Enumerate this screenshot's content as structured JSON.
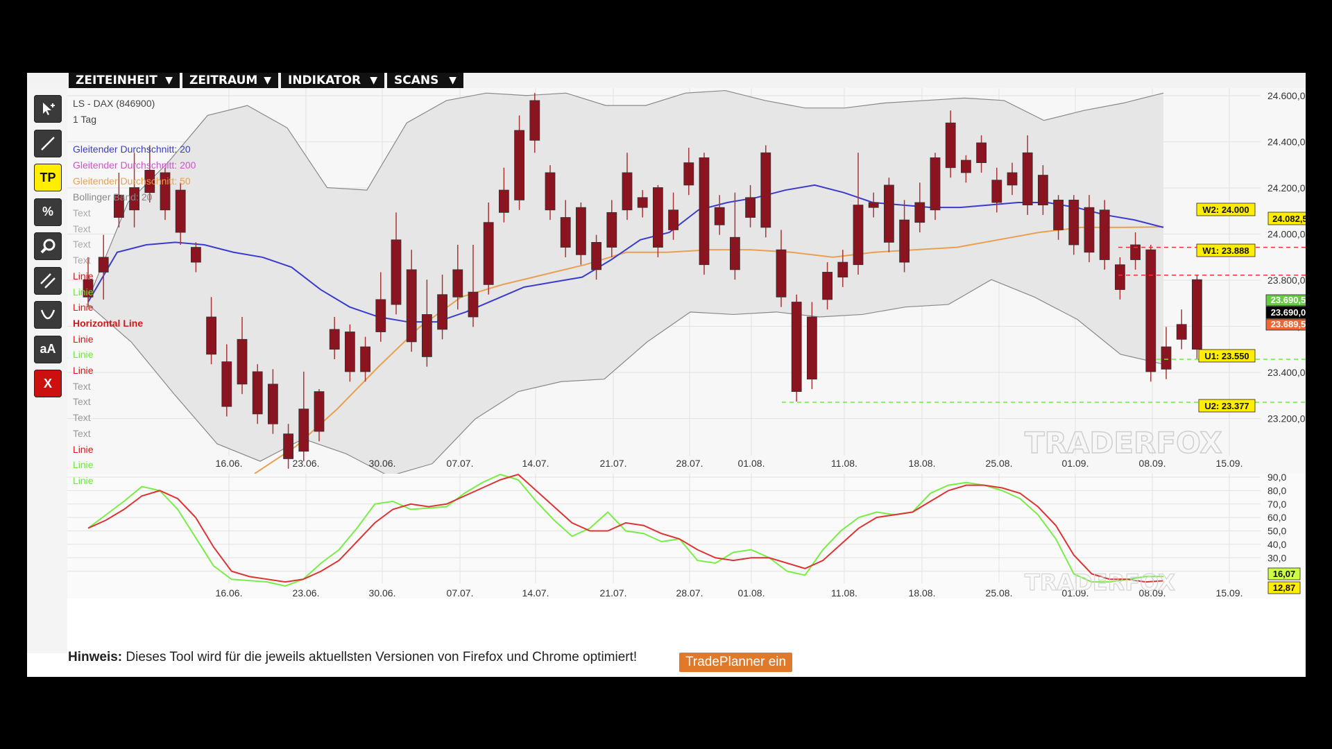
{
  "menu": [
    {
      "label": "ZEITEINHEIT",
      "arrow": "▼"
    },
    {
      "label": "ZEITRAUM",
      "arrow": "▼"
    },
    {
      "label": "INDIKATOR",
      "arrow": "▼"
    },
    {
      "label": "SCANS",
      "arrow": "▼"
    }
  ],
  "tools": [
    {
      "name": "pointer-icon"
    },
    {
      "name": "line-tool-icon"
    },
    {
      "name": "tradeplanner-tool",
      "label": "TP"
    },
    {
      "name": "percent-tool-icon",
      "label": "%"
    },
    {
      "name": "zoom-icon"
    },
    {
      "name": "parallel-lines-icon"
    },
    {
      "name": "curve-tool-icon"
    },
    {
      "name": "text-tool",
      "label": "aA"
    },
    {
      "name": "delete-tool",
      "label": "X"
    }
  ],
  "legend": {
    "instrument": "LS - DAX (846900)",
    "period": "1 Tag",
    "sma20": "Gleitender Durchschnitt: 20",
    "sma200": "Gleitender Durchschnitt: 200",
    "sma50": "Gleitender Durchschnitt: 50",
    "bollinger": "Bollinger Band: 20",
    "drawings": [
      {
        "label": "Text",
        "color": "#aaaaaa"
      },
      {
        "label": "Text",
        "color": "#aaaaaa"
      },
      {
        "label": "Text",
        "color": "#aaaaaa"
      },
      {
        "label": "Text",
        "color": "#aaaaaa"
      },
      {
        "label": "Linie",
        "color": "#d01818"
      },
      {
        "label": "Linie",
        "color": "#66ee33"
      },
      {
        "label": "Linie",
        "color": "#d01818"
      },
      {
        "label": "Horizontal Line",
        "color": "#d01818"
      },
      {
        "label": "Linie",
        "color": "#d01818"
      },
      {
        "label": "Linie",
        "color": "#66ee33"
      },
      {
        "label": "Linie",
        "color": "#d01818"
      },
      {
        "label": "Text",
        "color": "#999999"
      },
      {
        "label": "Text",
        "color": "#999999"
      },
      {
        "label": "Text",
        "color": "#999999"
      },
      {
        "label": "Text",
        "color": "#999999"
      },
      {
        "label": "Linie",
        "color": "#d01818"
      },
      {
        "label": "Linie",
        "color": "#66ee33"
      },
      {
        "label": "Linie",
        "color": "#66ee33"
      }
    ]
  },
  "levels": {
    "W2": "W2: 24.000",
    "W1": "W1: 23.888",
    "U1": "U1: 23.550",
    "U2": "U2: 23.377",
    "sma50_value": "24.082,57",
    "bid": "23.690,5",
    "last": "23.690,0",
    "ask": "23.689,5",
    "osc_k": "16,07",
    "osc_d": "12,87"
  },
  "watermark": "TRADERFOX",
  "footer": {
    "hint_label": "Hinweis:",
    "hint_text": " Dieses Tool wird für die jeweils aktuellsten Versionen von Firefox und Chrome optimiert!",
    "tradeplanner_button": "TradePlanner ein"
  },
  "colors": {
    "bull": "#3aa83a",
    "bear": "#8a1420",
    "sma20": "#3a3acc",
    "sma50": "#e8a050",
    "band": "#e6e6e6",
    "stoch_k": "#77ee44",
    "stoch_d": "#dd3333",
    "resistance": "#ee3333",
    "support": "#66ee33"
  },
  "chart_data": [
    {
      "type": "candlestick",
      "title": "LS - DAX (846900)",
      "x_tick_labels": [
        "16.06.",
        "23.06.",
        "30.06.",
        "07.07.",
        "14.07.",
        "21.07.",
        "28.07.",
        "01.08.",
        "11.08.",
        "18.08.",
        "25.08.",
        "01.09.",
        "08.09.",
        "15.09."
      ],
      "y_tick_labels": [
        "24.600,0",
        "24.400,0",
        "24.200,0",
        "24.000,0",
        "23.800,0",
        "23.600,0",
        "23.400,0",
        "23.200,0"
      ],
      "ylim": [
        23090,
        24640
      ],
      "candles": [
        [
          23870,
          23960,
          23820,
          23800
        ],
        [
          23960,
          24050,
          23830,
          23900
        ],
        [
          24210,
          24300,
          24130,
          24120
        ],
        [
          24240,
          24380,
          24120,
          24150
        ],
        [
          24310,
          24410,
          24250,
          24220
        ],
        [
          24300,
          24320,
          24180,
          24150
        ],
        [
          24230,
          24260,
          24050,
          24060
        ],
        [
          24000,
          24020,
          23960,
          23940
        ],
        [
          23720,
          23800,
          23660,
          23570
        ],
        [
          23540,
          23610,
          23410,
          23360
        ],
        [
          23630,
          23720,
          23490,
          23450
        ],
        [
          23500,
          23530,
          23440,
          23330
        ],
        [
          23450,
          23510,
          23380,
          23290
        ],
        [
          23250,
          23290,
          23150,
          23150
        ],
        [
          23350,
          23500,
          23280,
          23180
        ],
        [
          23420,
          23430,
          23330,
          23260
        ],
        [
          23670,
          23720,
          23600,
          23590
        ],
        [
          23660,
          23690,
          23520,
          23500
        ],
        [
          23600,
          23640,
          23560,
          23500
        ],
        [
          23790,
          23900,
          23690,
          23660
        ],
        [
          24030,
          24140,
          23830,
          23770
        ],
        [
          23910,
          23990,
          23640,
          23620
        ],
        [
          23730,
          23870,
          23640,
          23560
        ],
        [
          23810,
          23890,
          23730,
          23670
        ],
        [
          23910,
          24010,
          23790,
          23800
        ],
        [
          23820,
          24010,
          23770,
          23720
        ],
        [
          24100,
          24180,
          23850,
          23850
        ],
        [
          24230,
          24320,
          24200,
          24140
        ],
        [
          24470,
          24530,
          24240,
          24190
        ],
        [
          24590,
          24620,
          24420,
          24430
        ],
        [
          24300,
          24330,
          24200,
          24150
        ],
        [
          24120,
          24190,
          24000,
          24000
        ],
        [
          24160,
          24180,
          23990,
          23970
        ],
        [
          24020,
          24050,
          23950,
          23910
        ],
        [
          24140,
          24190,
          24020,
          24000
        ],
        [
          24300,
          24380,
          24230,
          24150
        ],
        [
          24200,
          24230,
          24190,
          24160
        ],
        [
          24240,
          24250,
          24080,
          24000
        ],
        [
          24150,
          24220,
          24130,
          24070
        ],
        [
          24340,
          24400,
          24300,
          24250
        ],
        [
          24360,
          24380,
          23960,
          23930
        ],
        [
          24160,
          24210,
          24110,
          24090
        ],
        [
          24040,
          24220,
          23930,
          23910
        ],
        [
          24200,
          24250,
          24140,
          24120
        ],
        [
          24380,
          24410,
          24120,
          24080
        ],
        [
          23990,
          24070,
          23880,
          23800
        ],
        [
          23780,
          23810,
          23460,
          23420
        ],
        [
          23720,
          23780,
          23500,
          23470
        ],
        [
          23900,
          23940,
          23850,
          23790
        ],
        [
          23940,
          23990,
          23930,
          23880
        ],
        [
          24170,
          24380,
          23970,
          23930
        ],
        [
          24180,
          24220,
          24180,
          24160
        ],
        [
          24250,
          24280,
          24060,
          24020
        ],
        [
          24110,
          24190,
          24050,
          23940
        ],
        [
          24180,
          24260,
          24140,
          24100
        ],
        [
          24360,
          24380,
          24170,
          24150
        ],
        [
          24500,
          24550,
          24390,
          24320
        ],
        [
          24350,
          24370,
          24330,
          24300
        ],
        [
          24420,
          24450,
          24370,
          24340
        ],
        [
          24270,
          24320,
          24240,
          24180
        ],
        [
          24300,
          24340,
          24260,
          24250
        ],
        [
          24380,
          24450,
          24230,
          24170
        ],
        [
          24290,
          24330,
          24250,
          24170
        ],
        [
          24190,
          24210,
          24140,
          24070
        ],
        [
          24190,
          24210,
          24120,
          24010
        ],
        [
          24160,
          24210,
          24010,
          23980
        ],
        [
          24150,
          24190,
          24000,
          23950
        ],
        [
          23930,
          23960,
          23900,
          23830
        ],
        [
          24010,
          24060,
          23970,
          23950
        ],
        [
          23990,
          24010,
          23520,
          23500
        ],
        [
          23600,
          23680,
          23580,
          23510
        ],
        [
          23690,
          23750,
          23650,
          23630
        ],
        [
          23870,
          23890,
          23630,
          23590
        ]
      ],
      "sma20": [
        23780,
        23980,
        24010,
        24020,
        24010,
        23980,
        23960,
        23920,
        23830,
        23760,
        23720,
        23700,
        23700,
        23740,
        23790,
        23840,
        23860,
        23880,
        23950,
        24030,
        24060,
        24150,
        24180,
        24200,
        24230,
        24250,
        24220,
        24180,
        24170,
        24160,
        24160,
        24170,
        24180,
        24180,
        24160,
        24130,
        24110,
        24080
      ],
      "sma50": [
        23090,
        23200,
        23350,
        23520,
        23680,
        23800,
        23850,
        23890,
        23930,
        23980,
        23980,
        23990,
        23990,
        23980,
        23960,
        23980,
        23990,
        24000,
        24030,
        24060,
        24080,
        24080,
        24082
      ],
      "bb_upper": [
        23790,
        24180,
        24340,
        24530,
        24570,
        24480,
        24240,
        24230,
        24500,
        24590,
        24620,
        24610,
        24620,
        24570,
        24570,
        24620,
        24630,
        24590,
        24560,
        24560,
        24580,
        24590,
        24600,
        24590,
        24510,
        24550,
        24580,
        24620
      ],
      "bb_lower": [
        23770,
        23620,
        23410,
        23210,
        23140,
        23230,
        23170,
        23080,
        23130,
        23310,
        23420,
        23460,
        23470,
        23620,
        23740,
        23730,
        23740,
        23720,
        23730,
        23760,
        23770,
        23870,
        23800,
        23710,
        23570,
        23530
      ],
      "annotations": [
        "W2: 24.000",
        "W1: 23.888",
        "U1: 23.550",
        "U2: 23.377"
      ]
    },
    {
      "type": "line",
      "title": "",
      "y_tick_labels": [
        "90,0",
        "80,0",
        "70,0",
        "60,0",
        "50,0",
        "40,0",
        "30,0",
        "20,0"
      ],
      "ylim": [
        10,
        90
      ],
      "series": [
        {
          "values": [
            52,
            62,
            72,
            83,
            80,
            66,
            45,
            24,
            14,
            13,
            12,
            9,
            14,
            26,
            36,
            52,
            70,
            72,
            66,
            67,
            68,
            78,
            86,
            92,
            88,
            72,
            58,
            46,
            52,
            64,
            50,
            48,
            42,
            44,
            28,
            26,
            34,
            36,
            30,
            20,
            17,
            36,
            50,
            60,
            64,
            62,
            64,
            78,
            84,
            86,
            84,
            80,
            74,
            62,
            44,
            18,
            12,
            12,
            14,
            16,
            16.07
          ]
        },
        {
          "values": [
            52,
            58,
            66,
            76,
            80,
            74,
            60,
            38,
            20,
            16,
            14,
            12,
            14,
            20,
            28,
            42,
            56,
            66,
            70,
            68,
            70,
            76,
            82,
            88,
            92,
            80,
            68,
            56,
            50,
            50,
            56,
            54,
            48,
            44,
            36,
            30,
            28,
            30,
            30,
            26,
            22,
            28,
            40,
            52,
            60,
            62,
            64,
            72,
            80,
            84,
            84,
            82,
            78,
            68,
            54,
            32,
            18,
            14,
            14,
            12,
            12.87
          ]
        }
      ]
    }
  ]
}
